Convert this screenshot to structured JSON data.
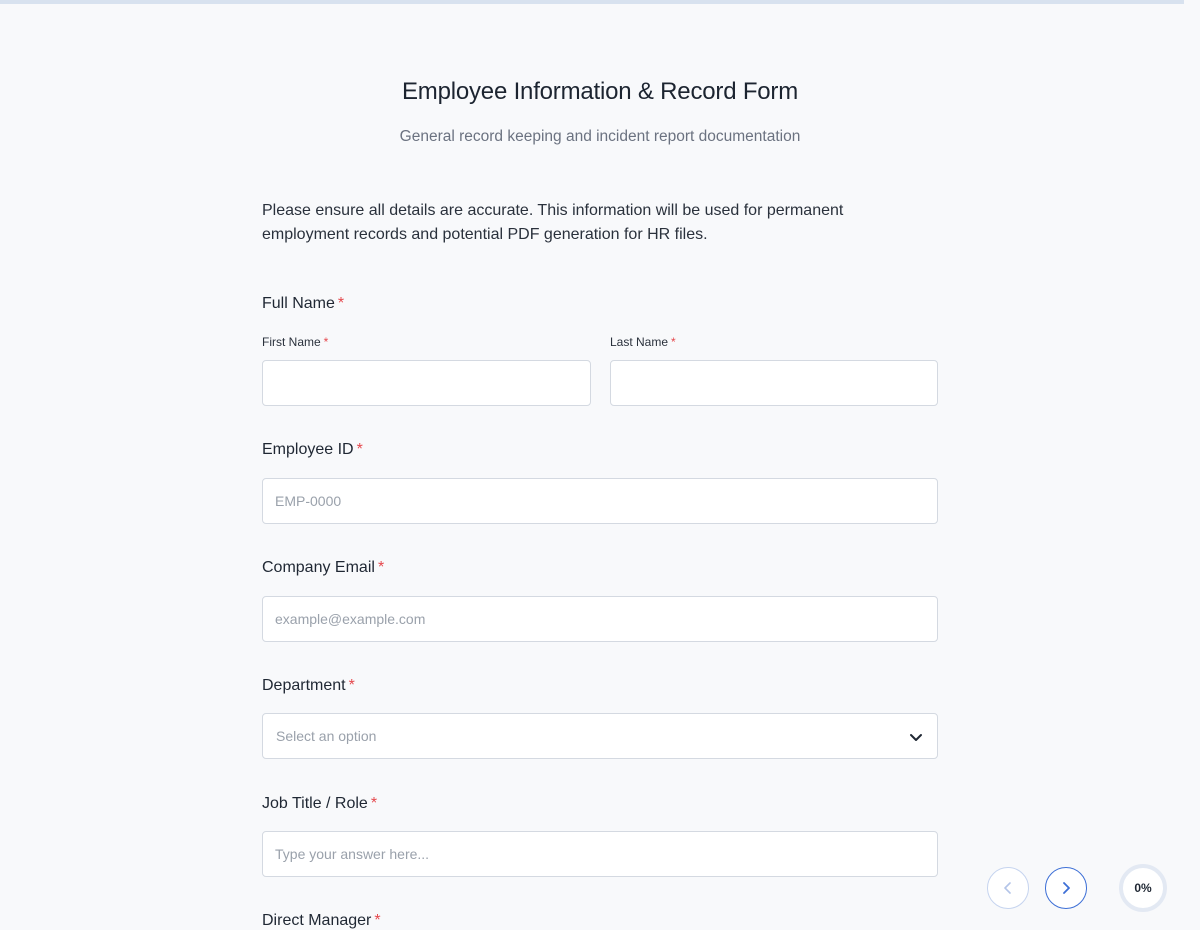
{
  "form": {
    "title": "Employee Information & Record Form",
    "subtitle": "General record keeping and incident report documentation",
    "intro": "Please ensure all details are accurate. This information will be used for permanent employment records and potential PDF generation for HR files."
  },
  "fields": {
    "full_name": {
      "label": "Full Name",
      "first_label": "First Name",
      "first_value": "",
      "last_label": "Last Name",
      "last_value": ""
    },
    "employee_id": {
      "label": "Employee ID",
      "placeholder": "EMP-0000",
      "value": ""
    },
    "company_email": {
      "label": "Company Email",
      "placeholder": "example@example.com",
      "value": ""
    },
    "department": {
      "label": "Department",
      "selected": "Select an option"
    },
    "job_title": {
      "label": "Job Title / Role",
      "placeholder": "Type your answer here...",
      "value": ""
    },
    "direct_manager": {
      "label": "Direct Manager"
    }
  },
  "required_marker": "*",
  "navigation": {
    "prev_icon": "chevron-left-icon",
    "next_icon": "chevron-right-icon",
    "progress_label": "0%",
    "progress_value": 0
  },
  "colors": {
    "required": "#e5484d",
    "accent": "#3d6fd6",
    "background": "#f8f9fb"
  }
}
